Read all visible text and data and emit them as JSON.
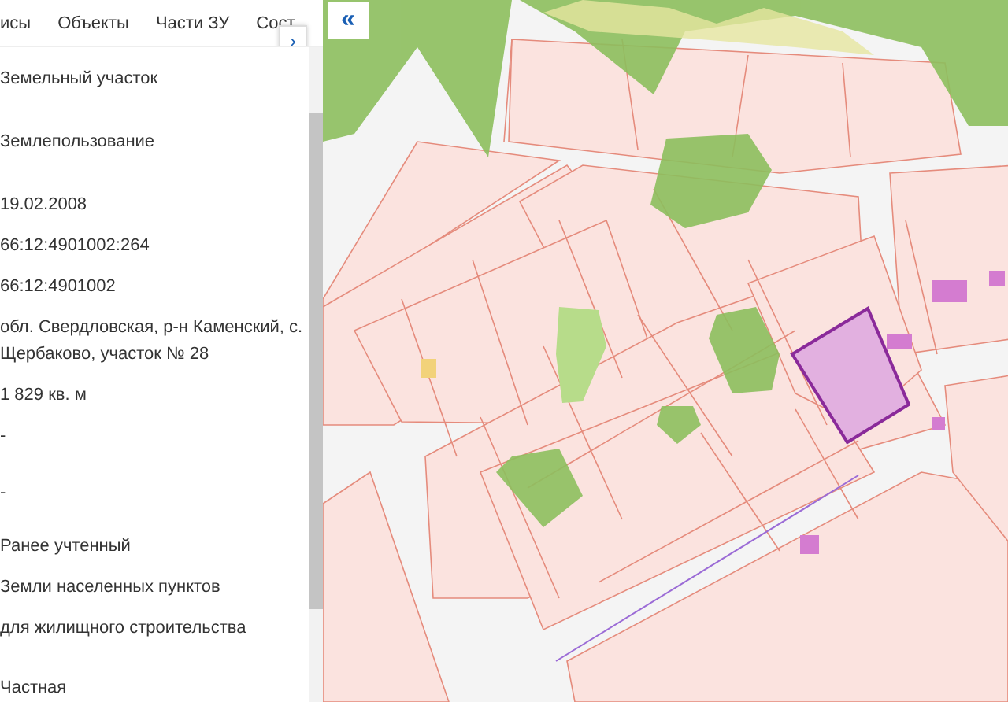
{
  "tabs": [
    {
      "label": "исы",
      "selected": false
    },
    {
      "label": "Объекты",
      "selected": false
    },
    {
      "label": "Части ЗУ",
      "selected": false
    },
    {
      "label": "Сост",
      "selected": false
    }
  ],
  "tabs_next": "›",
  "fields": [
    "Земельный участок",
    "Землепользование",
    "19.02.2008",
    "66:12:4901002:264",
    "66:12:4901002",
    "обл. Свердловская, р-н Каменский, с. Щербаково, участок № 28",
    "1 829 кв. м",
    "-",
    "-",
    "Ранее учтенный",
    "Земли населенных пунктов",
    "для жилищного строительства",
    "Частная"
  ],
  "map": {
    "collapse_button": "«"
  }
}
